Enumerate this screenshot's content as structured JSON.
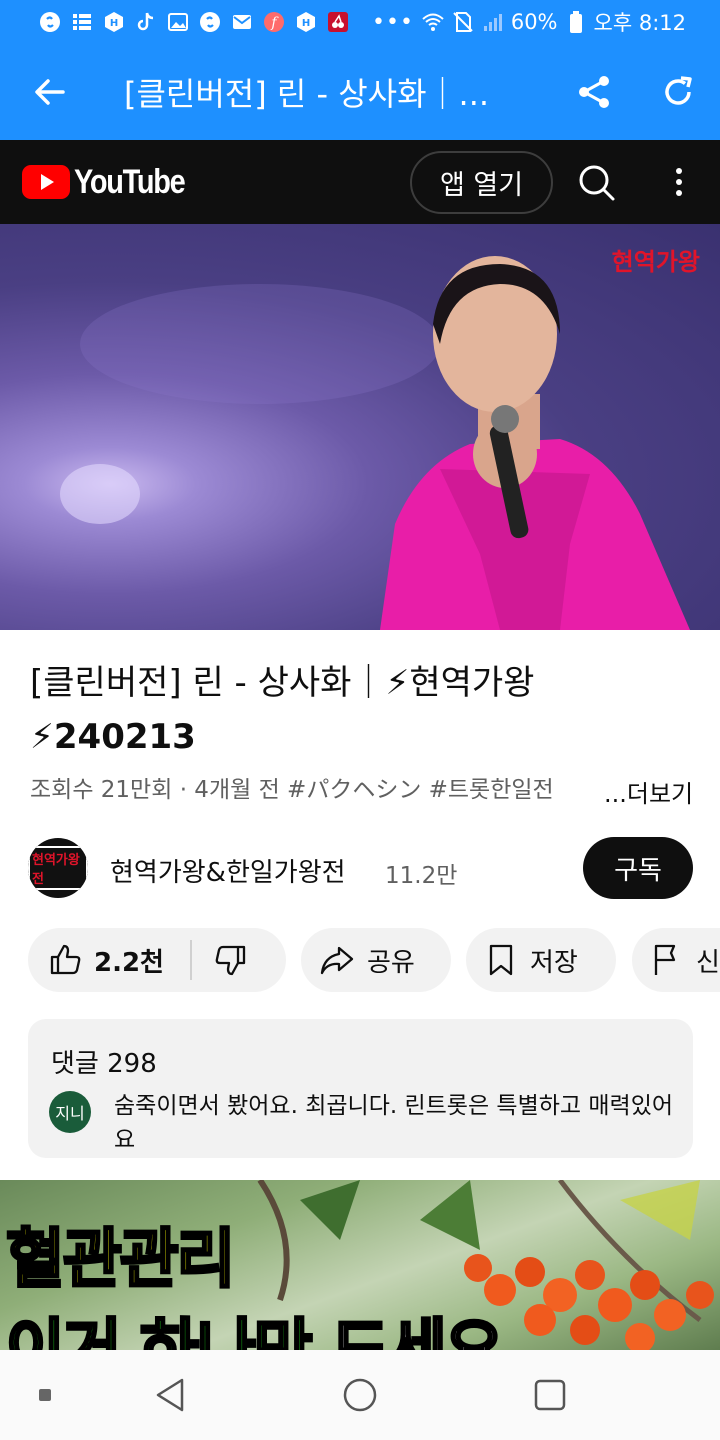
{
  "status_bar": {
    "battery": "60%",
    "time": "오후 8:12",
    "dots": "•••"
  },
  "app_bar": {
    "title": "[클린버전] 린 - 상사화｜..."
  },
  "youtube_header": {
    "logo_text": "YouTube",
    "open_app_label": "앱 열기"
  },
  "video": {
    "watermark": "현역가왕"
  },
  "video_info": {
    "title_line1": "[클린버전] 린 - 상사화｜⚡현역가왕",
    "title_line2": "⚡240213",
    "meta": "조회수 21만회 · 4개월 전  #パクヘシン #트롯한일전",
    "more_label": "...더보기"
  },
  "channel": {
    "avatar_text": "현역가왕전",
    "name": "현역가왕&한일가왕전",
    "subscribers": "11.2만",
    "subscribe_label": "구독"
  },
  "actions": {
    "like_count": "2.2천",
    "share_label": "공유",
    "save_label": "저장",
    "report_label": "신"
  },
  "comments": {
    "header": "댓글 298",
    "avatar_text": "지니",
    "text": "숨죽이면서 봤어요. 최곱니다. 린트롯은 특별하고 매력있어요"
  },
  "ad": {
    "line1": "혈관관리",
    "line2a": "이거 하나만",
    "line2b": " 드세요"
  },
  "colors": {
    "app_bar": "#1e90ff",
    "youtube_red": "#ff0000",
    "yt_header": "#0f0f0f"
  }
}
